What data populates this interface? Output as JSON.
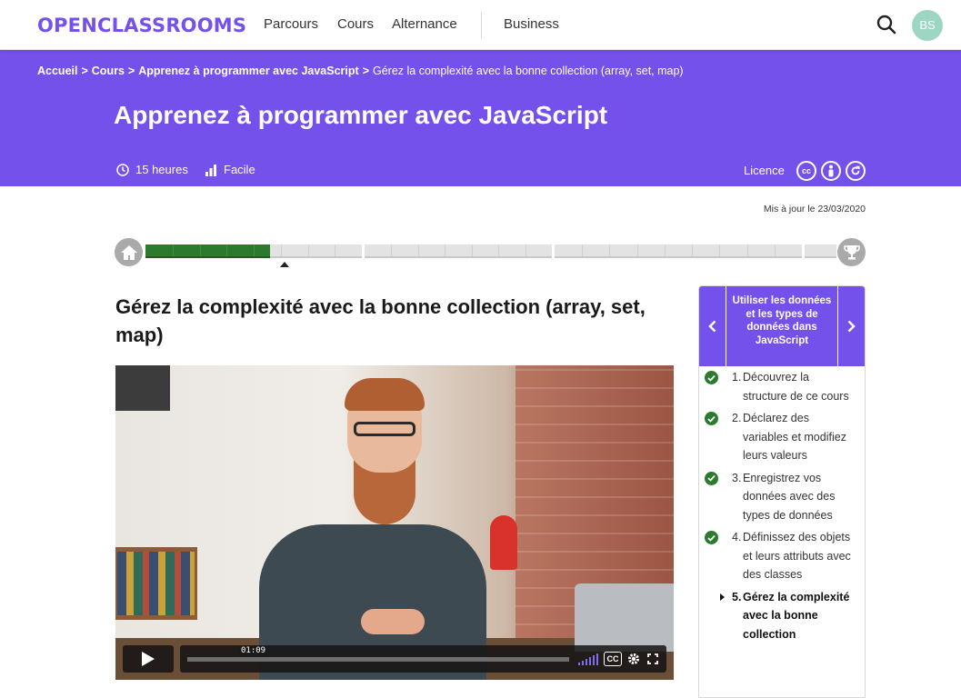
{
  "nav": {
    "logo": "OPENCLASSROOMS",
    "links": [
      "Parcours",
      "Cours",
      "Alternance",
      "Business"
    ],
    "avatar_initials": "BS"
  },
  "header": {
    "breadcrumb": [
      "Accueil",
      "Cours",
      "Apprenez à programmer avec JavaScript",
      "Gérez la complexité avec la bonne collection (array, set, map)"
    ],
    "course_title": "Apprenez à programmer avec JavaScript",
    "duration": "15 heures",
    "difficulty": "Facile",
    "licence_label": "Licence",
    "colors": {
      "brand": "#7451eb"
    }
  },
  "updated": "Mis à jour le 23/03/2020",
  "progress": {
    "completed_fraction": 0.18
  },
  "chapter": {
    "title": "Gérez la complexité avec la bonne collection (array, set, map)"
  },
  "video": {
    "current_time": "01:09",
    "icons": [
      "play-icon",
      "volume-icon",
      "cc-icon",
      "settings-icon",
      "fullscreen-icon"
    ]
  },
  "sidebar": {
    "part_title": "Utiliser les données et les types de données dans JavaScript",
    "items": [
      {
        "num": "1.",
        "label": "Découvrez la structure de ce cours",
        "done": true
      },
      {
        "num": "2.",
        "label": "Déclarez des variables et modifiez leurs valeurs",
        "done": true
      },
      {
        "num": "3.",
        "label": "Enregistrez vos données avec des types de données",
        "done": true
      },
      {
        "num": "4.",
        "label": "Définissez des objets et leurs attributs avec des classes",
        "done": true
      },
      {
        "num": "5.",
        "label": "Gérez la complexité avec la bonne collection",
        "done": false,
        "current": true
      }
    ]
  }
}
